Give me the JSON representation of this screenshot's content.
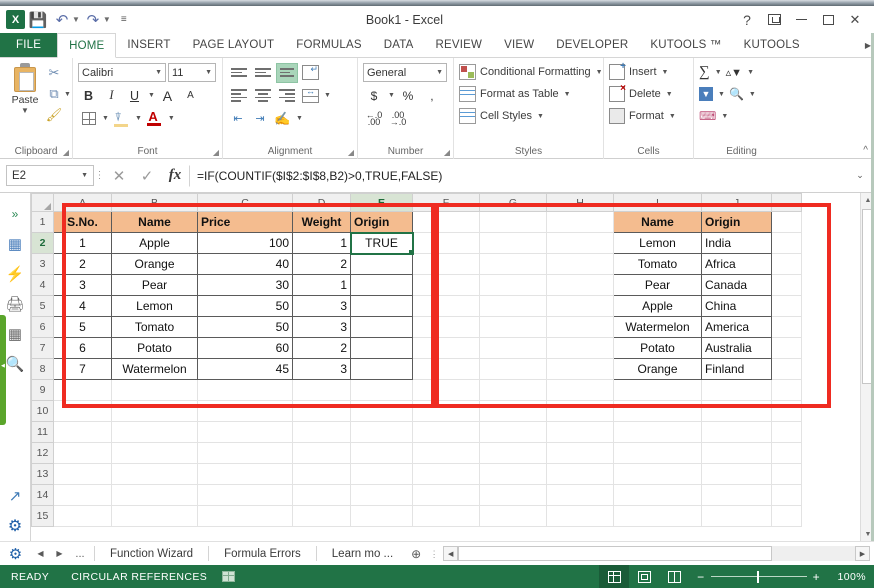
{
  "window": {
    "title": "Book1 - Excel",
    "top_sliver_text": "·······  ········  ······  ········  ·······",
    "controls": {
      "help": "?",
      "ribbon_display_options": "ribbon-display-options",
      "minimize": "minimize",
      "maximize": "maximize",
      "close": "close"
    }
  },
  "quick_access": {
    "logo": "X",
    "save": "save",
    "undo": "undo",
    "redo": "redo",
    "customize": "customize"
  },
  "ribbon_tabs": [
    {
      "label": "FILE",
      "state": "file"
    },
    {
      "label": "HOME",
      "state": "active"
    },
    {
      "label": "INSERT",
      "state": ""
    },
    {
      "label": "PAGE LAYOUT",
      "state": ""
    },
    {
      "label": "FORMULAS",
      "state": ""
    },
    {
      "label": "DATA",
      "state": ""
    },
    {
      "label": "REVIEW",
      "state": ""
    },
    {
      "label": "VIEW",
      "state": ""
    },
    {
      "label": "DEVELOPER",
      "state": ""
    },
    {
      "label": "KUTOOLS ™",
      "state": ""
    },
    {
      "label": "KUTOOLS",
      "state": ""
    }
  ],
  "ribbon": {
    "clipboard": {
      "label": "Clipboard",
      "paste": "Paste",
      "cut": "✂",
      "copy": "⧉",
      "format_painter": "🖌"
    },
    "font": {
      "label": "Font",
      "font_name": "Calibri",
      "font_size": "11",
      "bold": "B",
      "italic": "I",
      "underline": "U",
      "grow_font": "A",
      "shrink_font": "A"
    },
    "alignment": {
      "label": "Alignment"
    },
    "number": {
      "label": "Number",
      "format": "General",
      "currency": "$",
      "percent": "%",
      "comma": ","
    },
    "styles": {
      "label": "Styles",
      "conditional_formatting": "Conditional Formatting",
      "format_as_table": "Format as Table",
      "cell_styles": "Cell Styles"
    },
    "cells": {
      "label": "Cells",
      "insert": "Insert",
      "delete": "Delete",
      "format": "Format"
    },
    "editing": {
      "label": "Editing",
      "autosum": "∑",
      "sort_filter": "sort-filter",
      "fill": "fill",
      "find_select": "find-select",
      "clear": "clear"
    },
    "collapse": "^"
  },
  "formula_bar": {
    "name_box": "E2",
    "cancel": "✕",
    "enter": "✓",
    "insert_function": "fx",
    "formula": "=IF(COUNTIF($I$2:$I$8,B2)>0,TRUE,FALSE)",
    "expand": "⌄"
  },
  "left_pane": {
    "icons": [
      "chevron-double-right-icon",
      "worksheet-icon",
      "quick-action-icon",
      "printer-icon",
      "columns-icon",
      "binoculars-icon",
      "external-link-icon",
      "gear-icon"
    ]
  },
  "grid": {
    "column_headers": [
      "A",
      "B",
      "C",
      "D",
      "E",
      "F",
      "G",
      "H",
      "I",
      "J"
    ],
    "selected_column": "E",
    "row_headers": [
      "1",
      "2",
      "3",
      "4",
      "5",
      "6",
      "7",
      "8",
      "9",
      "10",
      "11",
      "12",
      "13",
      "14",
      "15"
    ],
    "selected_row": "2",
    "selected_cell": "E2",
    "left_table": {
      "headers": [
        "S.No.",
        "Name",
        "Price",
        "Weight",
        "Origin"
      ],
      "rows": [
        [
          "1",
          "Apple",
          "100",
          "1",
          "TRUE"
        ],
        [
          "2",
          "Orange",
          "40",
          "2",
          ""
        ],
        [
          "3",
          "Pear",
          "30",
          "1",
          ""
        ],
        [
          "4",
          "Lemon",
          "50",
          "3",
          ""
        ],
        [
          "5",
          "Tomato",
          "50",
          "3",
          ""
        ],
        [
          "6",
          "Potato",
          "60",
          "2",
          ""
        ],
        [
          "7",
          "Watermelon",
          "45",
          "3",
          ""
        ]
      ]
    },
    "right_table": {
      "headers": [
        "Name",
        "Origin"
      ],
      "rows": [
        [
          "Lemon",
          "India"
        ],
        [
          "Tomato",
          "Africa"
        ],
        [
          "Pear",
          "Canada"
        ],
        [
          "Apple",
          "China"
        ],
        [
          "Watermelon",
          "America"
        ],
        [
          "Potato",
          "Australia"
        ],
        [
          "Orange",
          "Finland"
        ]
      ]
    },
    "header_fill_color": "#F4BC8F",
    "annotation_color": "#EF2B21"
  },
  "sheet_tabs": {
    "first": "◀",
    "prev": "◀",
    "next": "▶",
    "dots": "...",
    "tabs": [
      "Function Wizard",
      "Formula Errors",
      "Learn mo ..."
    ],
    "add_sheet": "⊕"
  },
  "status_bar": {
    "mode": "READY",
    "message": "CIRCULAR REFERENCES",
    "views": [
      "normal-view",
      "page-layout-view",
      "page-break-view"
    ],
    "zoom_minus": "−",
    "zoom_plus": "+",
    "zoom_level": "100%"
  }
}
